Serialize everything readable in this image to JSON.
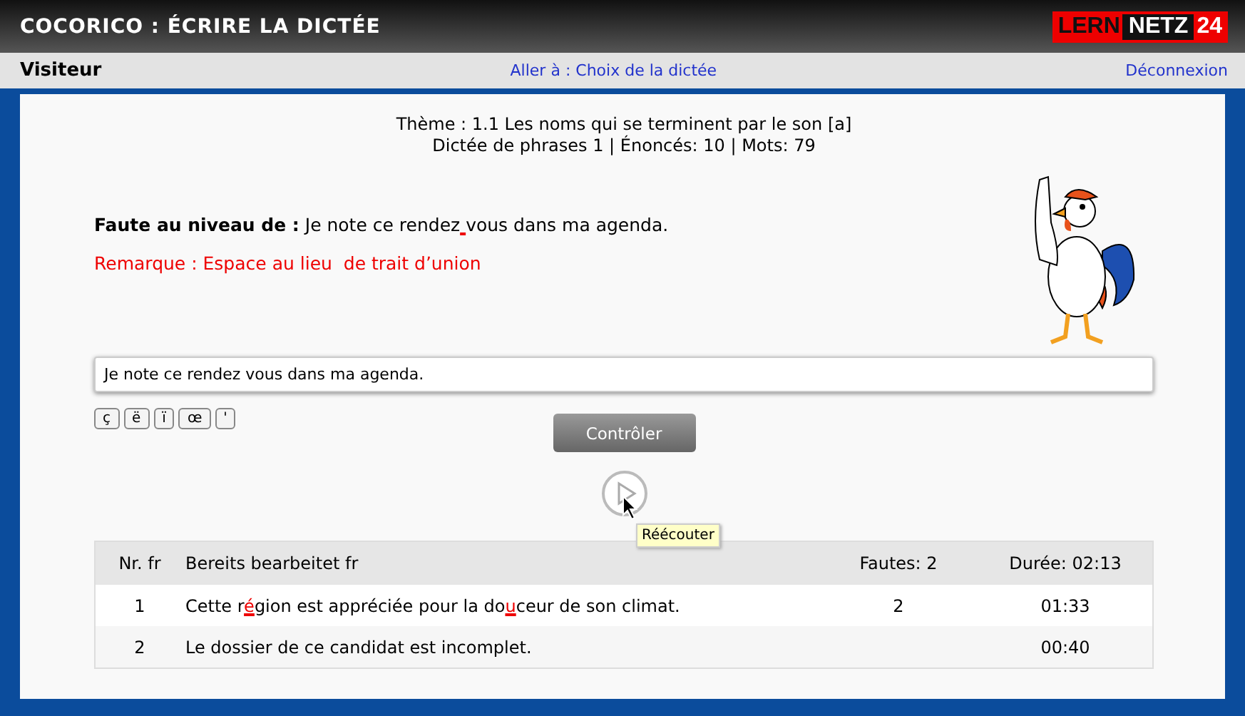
{
  "header": {
    "title": "COCORICO : ÉCRIRE LA DICTÉE",
    "logo": [
      "LERN",
      "NETZ",
      "24"
    ]
  },
  "nav": {
    "user": "Visiteur",
    "goto": "Aller à : Choix de la dictée",
    "logout": "Déconnexion"
  },
  "info": [
    "Thème : 1.1 Les noms qui se terminent par le son [a]",
    "Dictée de phrases 1 | Énoncés: 10 | Mots: 79"
  ],
  "fault": {
    "label": "Faute au niveau de :",
    "segments": [
      {
        "text": "Je note ce rendez",
        "error": false,
        "gap_error": true
      },
      {
        "text": "vous dans ma agenda.",
        "error": false,
        "gap_error": false
      }
    ]
  },
  "remark": "Remarque : Espace au lieu  de trait d’union",
  "answer": {
    "value": "Je note ce rendez vous dans ma agenda."
  },
  "char_keys": [
    "ç",
    "ë",
    "ï",
    "œ",
    "'"
  ],
  "check_button": "Contrôler",
  "tooltip": "Réécouter",
  "table": {
    "columns": [
      "Nr. fr",
      "Bereits bearbeitet fr",
      "Fautes: 2",
      "Durée: 02:13"
    ],
    "rows": [
      {
        "nr": "1",
        "segments": [
          {
            "text": "Cette r",
            "error": false
          },
          {
            "text": "é",
            "error": true
          },
          {
            "text": "gion est appréciée pour la do",
            "error": false
          },
          {
            "text": "u",
            "error": true
          },
          {
            "text": "ceur de son climat.",
            "error": false
          }
        ],
        "faults": "2",
        "duration": "01:33"
      },
      {
        "nr": "2",
        "segments": [
          {
            "text": "Le dossier de ce candidat est incomplet.",
            "error": false
          }
        ],
        "duration": "00:40"
      }
    ]
  }
}
